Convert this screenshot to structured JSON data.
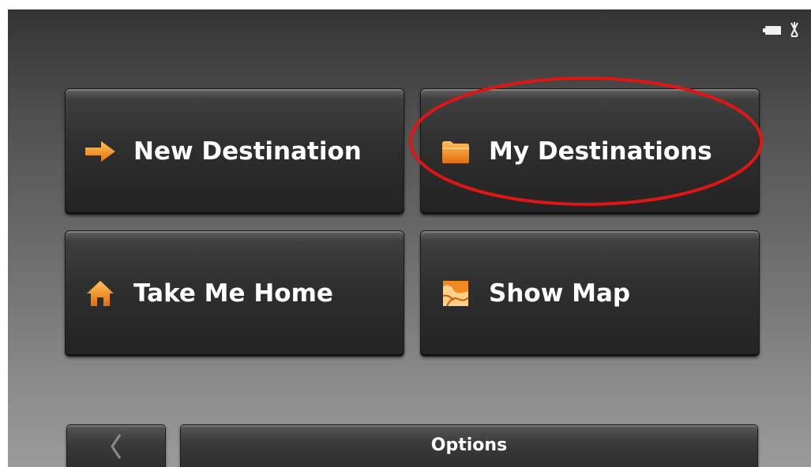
{
  "status_bar": {
    "battery_icon": "battery-icon",
    "gps_icon": "satellite-icon"
  },
  "menu": {
    "buttons": [
      {
        "label": "New Destination",
        "icon": "arrow-right-icon"
      },
      {
        "label": "My Destinations",
        "icon": "folder-icon"
      },
      {
        "label": "Take Me Home",
        "icon": "home-icon"
      },
      {
        "label": "Show Map",
        "icon": "map-icon"
      }
    ]
  },
  "footer": {
    "back_icon": "chevron-left-icon",
    "options_label": "Options"
  },
  "annotation": {
    "color": "#e01515"
  },
  "colors": {
    "accent": "#f28c18"
  }
}
